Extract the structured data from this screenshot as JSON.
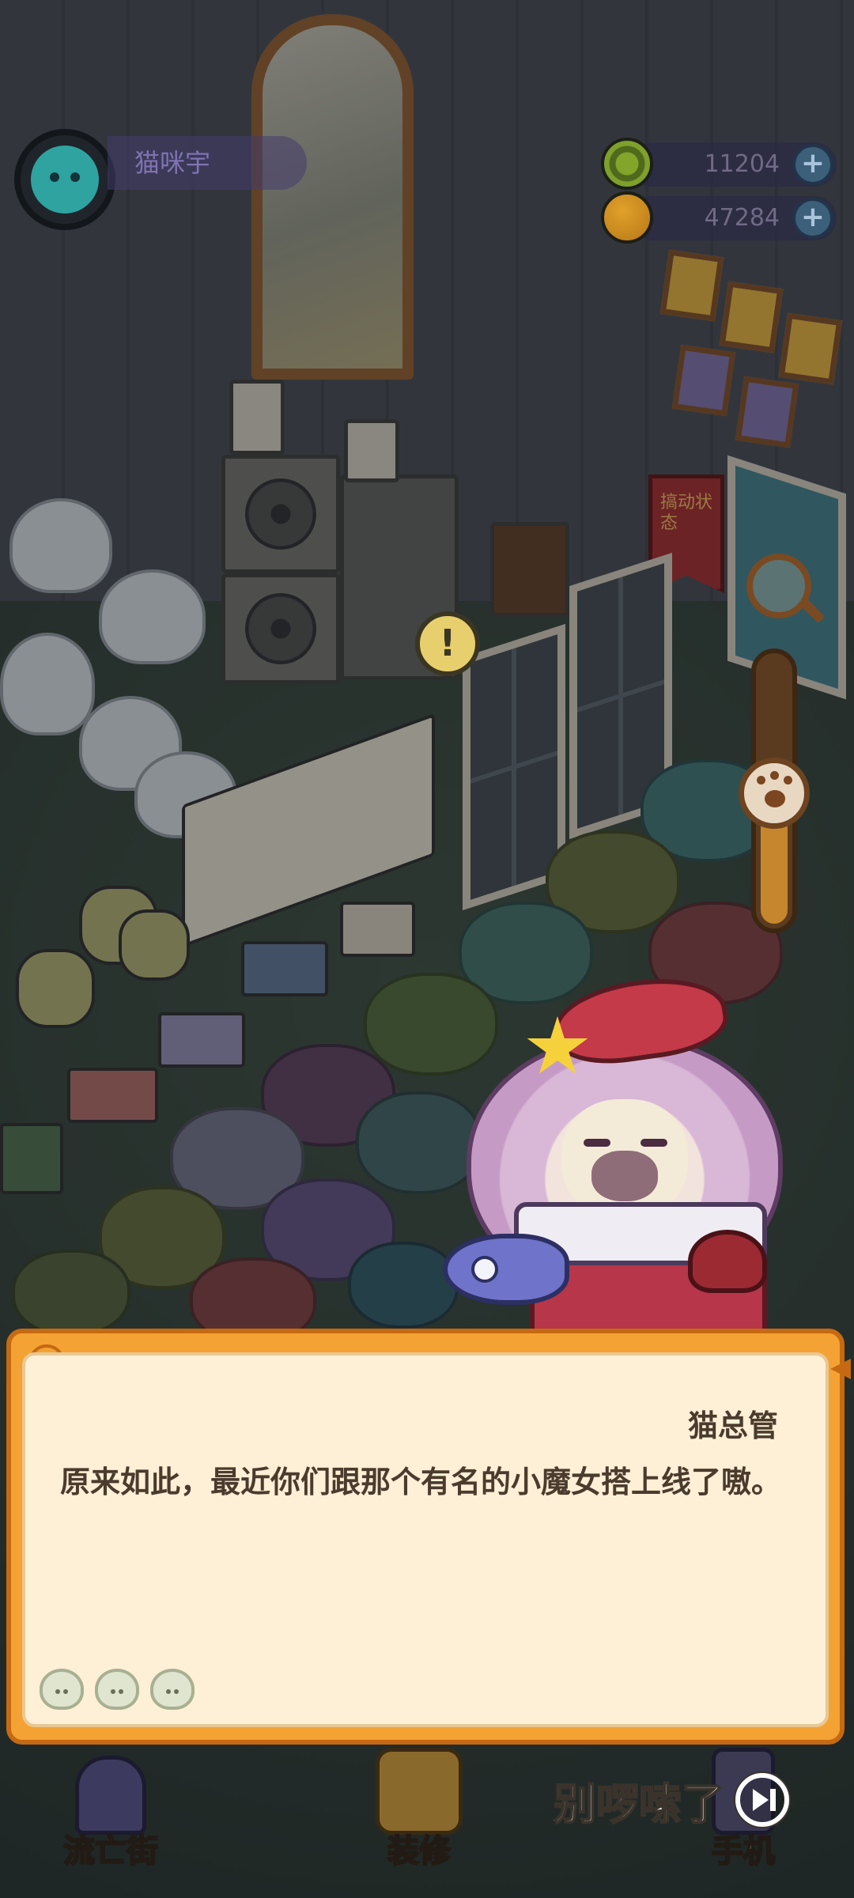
{
  "player": {
    "name": "猫咪宇"
  },
  "currencies": [
    {
      "icon": "green-coin-icon",
      "amount": "11204"
    },
    {
      "icon": "gold-coin-icon",
      "amount": "47284"
    }
  ],
  "scene": {
    "banner_text": "搞动状态"
  },
  "dialog": {
    "speaker": "猫总管",
    "text": "原来如此，最近你们跟那个有名的小魔女搭上线了嗷。"
  },
  "bottom_nav": {
    "street_label": "流亡街",
    "decorate_label": "装修",
    "phone_label": "手机"
  },
  "skip": {
    "label": "别啰嗦了"
  },
  "colors": {
    "dialog_frame": "#f4a233",
    "dialog_paper": "#fdf0d6",
    "dialog_text": "#4b3b2d"
  }
}
